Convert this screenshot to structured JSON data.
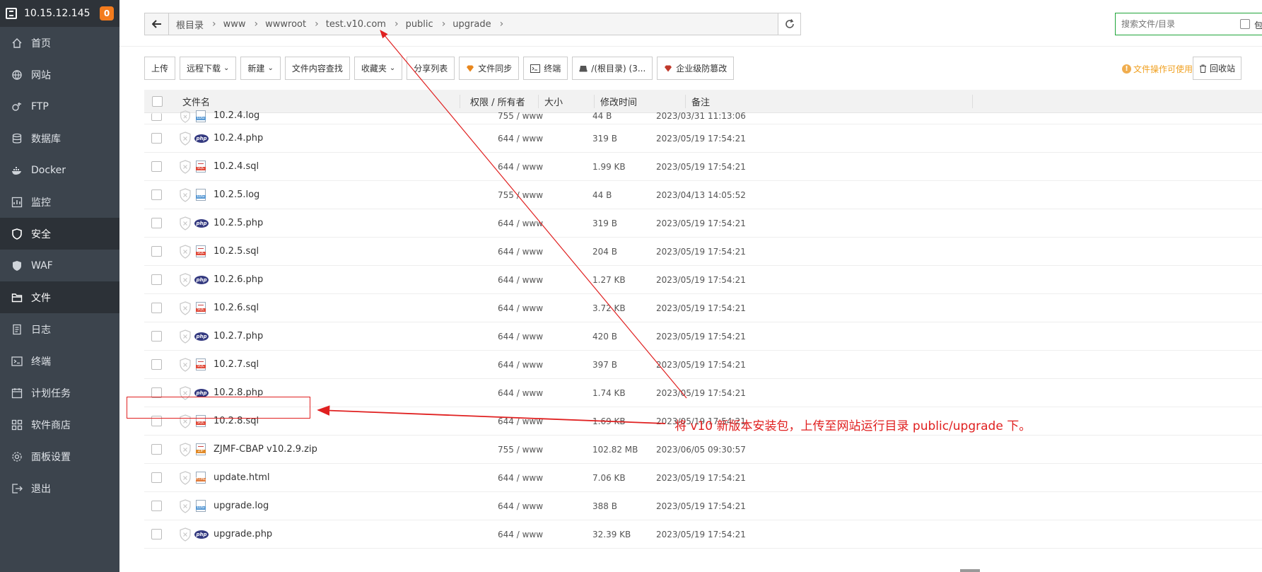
{
  "server": {
    "ip": "10.15.12.145",
    "badge": "0"
  },
  "sidebar": {
    "items": [
      {
        "label": "首页",
        "icon": "home-icon"
      },
      {
        "label": "网站",
        "icon": "globe-icon"
      },
      {
        "label": "FTP",
        "icon": "ftp-icon"
      },
      {
        "label": "数据库",
        "icon": "database-icon"
      },
      {
        "label": "Docker",
        "icon": "docker-icon"
      },
      {
        "label": "监控",
        "icon": "monitor-icon"
      },
      {
        "label": "安全",
        "icon": "shield-icon"
      },
      {
        "label": "WAF",
        "icon": "waf-icon"
      },
      {
        "label": "文件",
        "icon": "folder-icon"
      },
      {
        "label": "日志",
        "icon": "log-icon"
      },
      {
        "label": "终端",
        "icon": "terminal-icon"
      },
      {
        "label": "计划任务",
        "icon": "calendar-icon"
      },
      {
        "label": "软件商店",
        "icon": "apps-icon"
      },
      {
        "label": "面板设置",
        "icon": "gear-icon"
      },
      {
        "label": "退出",
        "icon": "logout-icon"
      }
    ]
  },
  "breadcrumb": [
    "根目录",
    "www",
    "wwwroot",
    "test.v10.com",
    "public",
    "upgrade"
  ],
  "search": {
    "placeholder": "搜索文件/目录",
    "checkbox_label": "包"
  },
  "toolbar": {
    "upload": "上传",
    "remote_download": "远程下载",
    "new": "新建",
    "content_search": "文件内容查找",
    "favorites": "收藏夹",
    "share_list": "分享列表",
    "file_sync": "文件同步",
    "terminal": "终端",
    "disk": "/(根目录) (3...",
    "tamper": "企业级防篡改",
    "tip": "文件操作可使用右键",
    "recycle": "回收站"
  },
  "table": {
    "headers": {
      "name": "文件名",
      "perm": "权限 / 所有者",
      "size": "大小",
      "mtime": "修改时间",
      "note": "备注"
    },
    "rows": [
      {
        "name": "10.2.4.log",
        "type": "log",
        "perm": "755 / www",
        "size": "44 B",
        "mtime": "2023/03/31 11:13:06"
      },
      {
        "name": "10.2.4.php",
        "type": "php",
        "perm": "644 / www",
        "size": "319 B",
        "mtime": "2023/05/19 17:54:21"
      },
      {
        "name": "10.2.4.sql",
        "type": "sql",
        "perm": "644 / www",
        "size": "1.99 KB",
        "mtime": "2023/05/19 17:54:21"
      },
      {
        "name": "10.2.5.log",
        "type": "log",
        "perm": "755 / www",
        "size": "44 B",
        "mtime": "2023/04/13 14:05:52"
      },
      {
        "name": "10.2.5.php",
        "type": "php",
        "perm": "644 / www",
        "size": "319 B",
        "mtime": "2023/05/19 17:54:21"
      },
      {
        "name": "10.2.5.sql",
        "type": "sql",
        "perm": "644 / www",
        "size": "204 B",
        "mtime": "2023/05/19 17:54:21"
      },
      {
        "name": "10.2.6.php",
        "type": "php",
        "perm": "644 / www",
        "size": "1.27 KB",
        "mtime": "2023/05/19 17:54:21"
      },
      {
        "name": "10.2.6.sql",
        "type": "sql",
        "perm": "644 / www",
        "size": "3.72 KB",
        "mtime": "2023/05/19 17:54:21"
      },
      {
        "name": "10.2.7.php",
        "type": "php",
        "perm": "644 / www",
        "size": "420 B",
        "mtime": "2023/05/19 17:54:21"
      },
      {
        "name": "10.2.7.sql",
        "type": "sql",
        "perm": "644 / www",
        "size": "397 B",
        "mtime": "2023/05/19 17:54:21"
      },
      {
        "name": "10.2.8.php",
        "type": "php",
        "perm": "644 / www",
        "size": "1.74 KB",
        "mtime": "2023/05/19 17:54:21"
      },
      {
        "name": "10.2.8.sql",
        "type": "sql",
        "perm": "644 / www",
        "size": "1.69 KB",
        "mtime": "2023/05/19 17:54:21"
      },
      {
        "name": "ZJMF-CBAP v10.2.9.zip",
        "type": "zip",
        "perm": "755 / www",
        "size": "102.82 MB",
        "mtime": "2023/06/05 09:30:57"
      },
      {
        "name": "update.html",
        "type": "html",
        "perm": "644 / www",
        "size": "7.06 KB",
        "mtime": "2023/05/19 17:54:21"
      },
      {
        "name": "upgrade.log",
        "type": "log",
        "perm": "644 / www",
        "size": "388 B",
        "mtime": "2023/05/19 17:54:21"
      },
      {
        "name": "upgrade.php",
        "type": "php",
        "perm": "644 / www",
        "size": "32.39 KB",
        "mtime": "2023/05/19 17:54:21"
      }
    ]
  },
  "annotation": "将 v10 新版本安装包，上传至网站运行目录 public/upgrade 下。",
  "colors": {
    "sidebar": "#3c444d",
    "accent": "#20a53a",
    "annotation": "#e02020",
    "badge": "#f37b1d"
  }
}
